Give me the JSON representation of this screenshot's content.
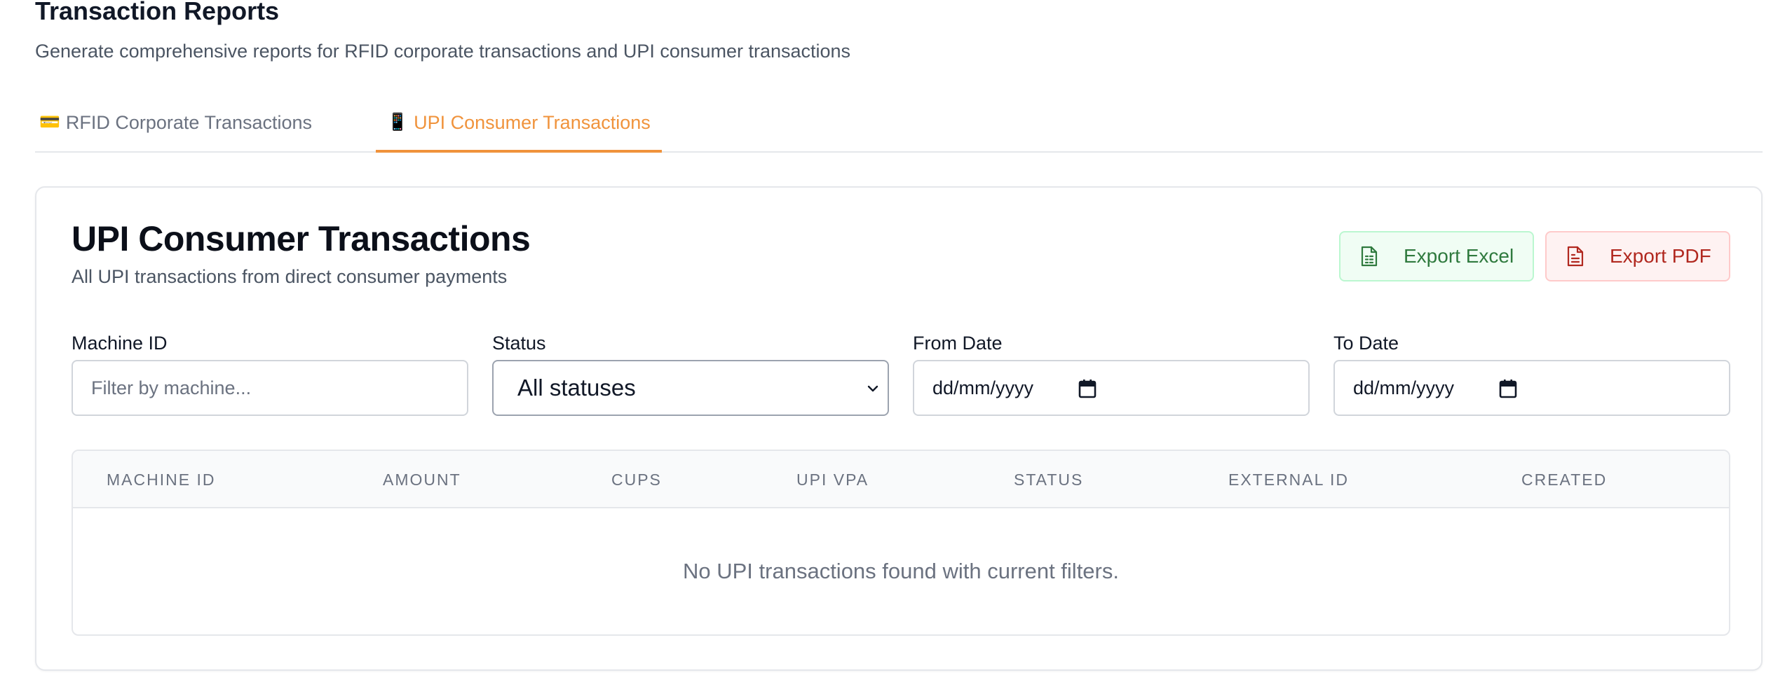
{
  "page": {
    "title": "Transaction Reports",
    "subtitle": "Generate comprehensive reports for RFID corporate transactions and UPI consumer transactions"
  },
  "tabs": [
    {
      "icon": "💳",
      "icon_name": "credit-card-icon",
      "label": "RFID Corporate Transactions",
      "active": false
    },
    {
      "icon": "📱",
      "icon_name": "mobile-phone-icon",
      "label": "UPI Consumer Transactions",
      "active": true
    }
  ],
  "card": {
    "title": "UPI Consumer Transactions",
    "subtitle": "All UPI transactions from direct consumer payments"
  },
  "actions": {
    "export_excel": "Export Excel",
    "export_pdf": "Export PDF"
  },
  "filters": {
    "machine_id": {
      "label": "Machine ID",
      "placeholder": "Filter by machine...",
      "value": ""
    },
    "status": {
      "label": "Status",
      "value": "All statuses"
    },
    "from_date": {
      "label": "From Date",
      "value": "dd/mm/yyyy"
    },
    "to_date": {
      "label": "To Date",
      "value": "dd/mm/yyyy"
    }
  },
  "table": {
    "columns": [
      "MACHINE ID",
      "AMOUNT",
      "CUPS",
      "UPI VPA",
      "STATUS",
      "EXTERNAL ID",
      "CREATED"
    ],
    "rows": [],
    "empty_message": "No UPI transactions found with current filters."
  },
  "colors": {
    "accent": "#f0933c",
    "excel_text": "#2f7a3e",
    "excel_bg": "#f0fdf4",
    "pdf_text": "#b1281f",
    "pdf_bg": "#fef2f2"
  }
}
